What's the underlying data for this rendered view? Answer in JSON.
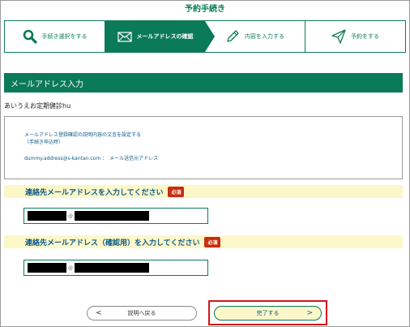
{
  "page_title": "予約手続き",
  "steps": [
    {
      "label": "手続き選択をする",
      "icon": "search-icon",
      "active": false
    },
    {
      "label": "メールアドレスの確認",
      "icon": "mail-icon",
      "active": true
    },
    {
      "label": "内容を入力する",
      "icon": "pencil-icon",
      "active": false
    },
    {
      "label": "予約をする",
      "icon": "send-icon",
      "active": false
    }
  ],
  "section_header": "メールアドレス入力",
  "user_line": "あいうえお定期健診hu",
  "info": {
    "line1": "メールアドレス登録確認の説明内容の文言を設定する",
    "line2": "（手続き申込時）",
    "address_line": "dummy.address@s-kantan.com ：　メール送信元アドレス"
  },
  "email_field": {
    "label": "連絡先メールアドレスを入力してください",
    "required_badge": "必須",
    "at": "@"
  },
  "email_confirm_field": {
    "label": "連絡先メールアドレス（確認用）を入力してください",
    "required_badge": "必須",
    "at": "@"
  },
  "buttons": {
    "back": "説明へ戻る",
    "complete": "完了する",
    "back_chevron": "<",
    "complete_chevron": ">"
  },
  "colors": {
    "brand_green": "#0b7a58",
    "label_blue": "#0b5a8a",
    "required_red": "#c82d10",
    "highlight_red": "#d51515",
    "label_bg": "#fcf7c9"
  }
}
